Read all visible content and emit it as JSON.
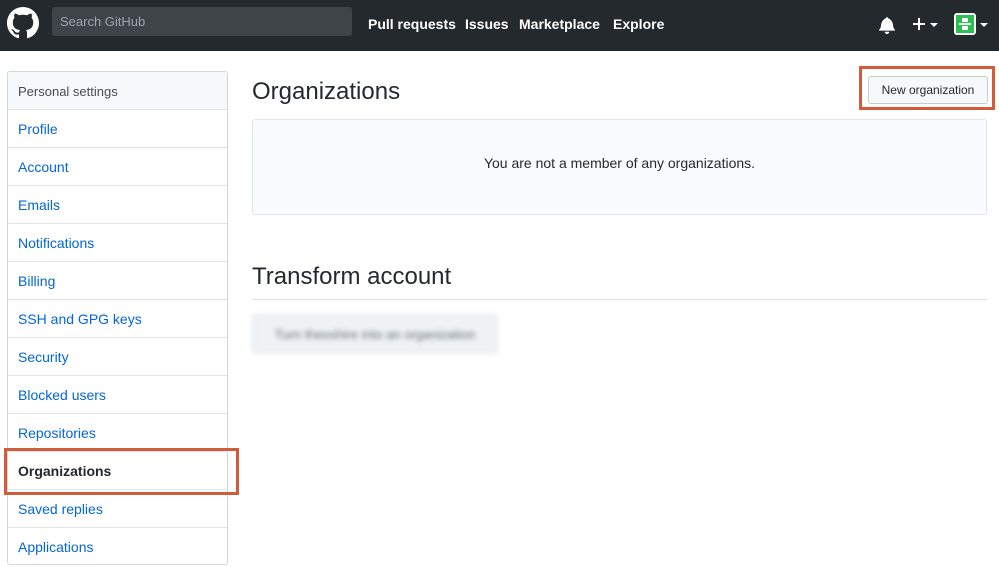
{
  "header": {
    "search_placeholder": "Search GitHub",
    "nav": {
      "pull_requests": "Pull requests",
      "issues": "Issues",
      "marketplace": "Marketplace",
      "explore": "Explore"
    },
    "icons": [
      "github-logo",
      "bell-icon",
      "plus-icon",
      "avatar"
    ],
    "background": "#24292e"
  },
  "sidebar": {
    "heading": "Personal settings",
    "items": [
      {
        "label": "Profile"
      },
      {
        "label": "Account"
      },
      {
        "label": "Emails"
      },
      {
        "label": "Notifications"
      },
      {
        "label": "Billing"
      },
      {
        "label": "SSH and GPG keys"
      },
      {
        "label": "Security"
      },
      {
        "label": "Blocked users"
      },
      {
        "label": "Repositories"
      },
      {
        "label": "Organizations",
        "selected": true
      },
      {
        "label": "Saved replies"
      },
      {
        "label": "Applications"
      }
    ]
  },
  "main": {
    "title": "Organizations",
    "new_button": "New organization",
    "blank_message": "You are not a member of any organizations.",
    "transform_title": "Transform account",
    "transform_button": "Turn theoshire into an organization"
  },
  "colors": {
    "link": "#0366d6",
    "highlight": "#d25c3a",
    "avatar": "#2cbe4e"
  }
}
